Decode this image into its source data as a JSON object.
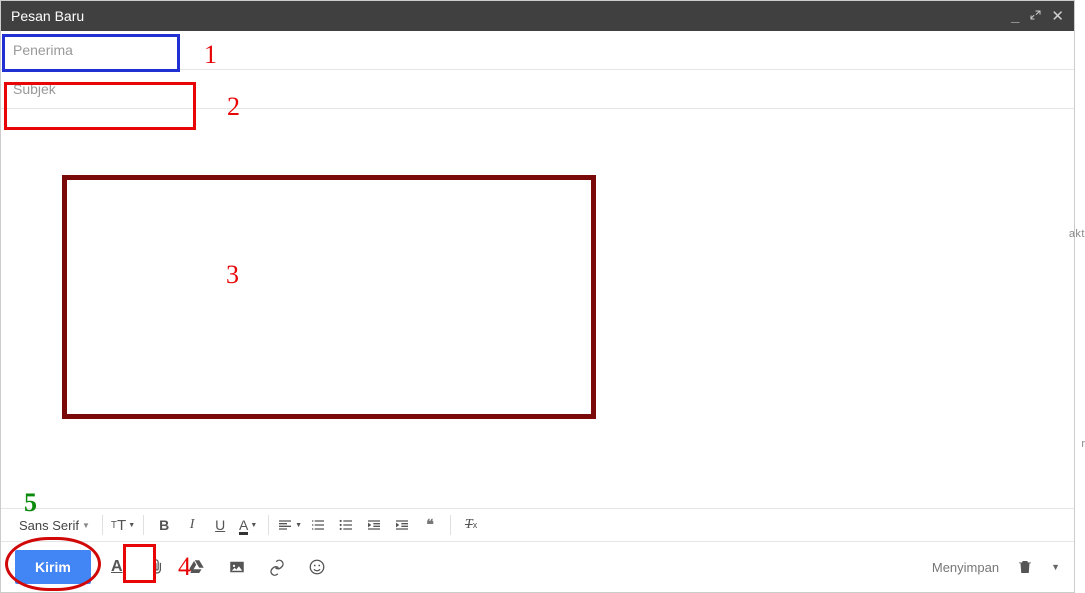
{
  "header": {
    "title": "Pesan Baru"
  },
  "fields": {
    "recipient_placeholder": "Penerima",
    "subject_placeholder": "Subjek"
  },
  "format": {
    "font_family": "Sans Serif",
    "size_label": "ᴛT",
    "bold": "B",
    "italic": "I",
    "underline": "U"
  },
  "actions": {
    "send_label": "Kirim"
  },
  "status": {
    "saving": "Menyimpan"
  },
  "annotations": {
    "n1": "1",
    "n2": "2",
    "n3": "3",
    "n4": "4",
    "n5": "5"
  }
}
